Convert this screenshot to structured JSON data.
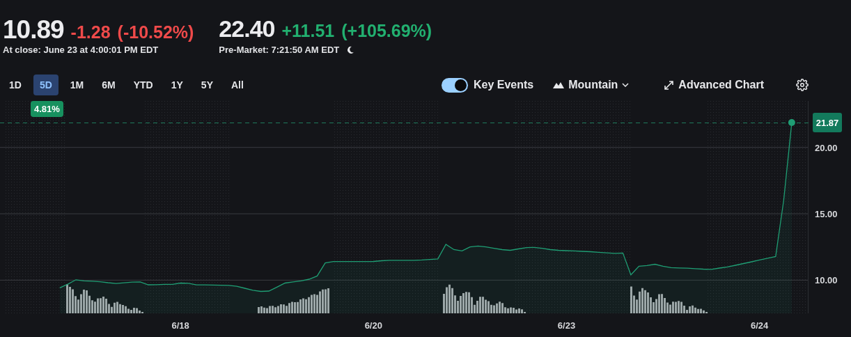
{
  "quote": {
    "close_price": "10.89",
    "close_change": "-1.28",
    "close_change_pct": "(-10.52%)",
    "close_time": "At close: June 23 at 4:00:01 PM EDT",
    "pre_price": "22.40",
    "pre_change": "+11.51",
    "pre_change_pct": "(+105.69%)",
    "pre_time": "Pre-Market: 7:21:50 AM EDT"
  },
  "ranges": [
    {
      "label": "1D",
      "selected": false
    },
    {
      "label": "5D",
      "selected": true
    },
    {
      "label": "1M",
      "selected": false
    },
    {
      "label": "6M",
      "selected": false
    },
    {
      "label": "YTD",
      "selected": false
    },
    {
      "label": "1Y",
      "selected": false
    },
    {
      "label": "5Y",
      "selected": false
    },
    {
      "label": "All",
      "selected": false
    }
  ],
  "range_change": "4.81%",
  "key_events": {
    "label": "Key Events",
    "on": true
  },
  "chart_type": "Mountain",
  "advanced_chart": "Advanced Chart",
  "chart": {
    "price_tag": "21.87",
    "chart_data": {
      "type": "area",
      "grid": true,
      "ylim": [
        7.5,
        23.5
      ],
      "yticks": [
        {
          "value": 10,
          "label": "10.00"
        },
        {
          "value": 15,
          "label": "15.00"
        },
        {
          "value": 20,
          "label": "20.00"
        }
      ],
      "categories": [
        null,
        null,
        null,
        null,
        null,
        null,
        null,
        null,
        null,
        null,
        null,
        null,
        null,
        null,
        null,
        "6/18",
        null,
        null,
        null,
        null,
        null,
        null,
        null,
        null,
        null,
        null,
        null,
        null,
        null,
        null,
        null,
        null,
        null,
        null,
        null,
        null,
        null,
        null,
        null,
        "6/20",
        null,
        null,
        null,
        null,
        null,
        null,
        null,
        null,
        null,
        null,
        null,
        null,
        null,
        null,
        null,
        null,
        null,
        null,
        null,
        null,
        null,
        null,
        null,
        "6/23",
        null,
        null,
        null,
        null,
        null,
        null,
        null,
        null,
        null,
        null,
        null,
        null,
        null,
        null,
        null,
        null,
        null,
        null,
        null,
        null,
        null,
        null,
        null,
        "6/24",
        null,
        null,
        null,
        null
      ],
      "series": [
        {
          "color": "#1f9e74",
          "values": [
            9.42,
            9.7,
            10.03,
            9.95,
            9.92,
            9.88,
            9.81,
            9.75,
            9.8,
            9.85,
            9.87,
            9.65,
            9.66,
            9.68,
            9.69,
            9.78,
            9.76,
            9.64,
            9.64,
            9.63,
            9.62,
            9.61,
            9.54,
            9.39,
            9.24,
            9.15,
            9.18,
            9.47,
            9.78,
            9.87,
            9.95,
            10.07,
            10.31,
            11.3,
            11.4,
            11.4,
            11.4,
            11.4,
            11.4,
            11.41,
            11.46,
            11.5,
            11.5,
            11.5,
            11.5,
            11.52,
            11.56,
            11.6,
            12.7,
            12.3,
            12.2,
            12.5,
            12.57,
            12.5,
            12.4,
            12.3,
            12.25,
            12.35,
            12.45,
            12.47,
            12.4,
            12.3,
            12.25,
            12.22,
            12.2,
            12.17,
            12.14,
            12.1,
            12.06,
            12.02,
            12.05,
            10.4,
            11.05,
            11.1,
            11.2,
            11.05,
            10.94,
            10.92,
            10.9,
            10.87,
            10.83,
            10.81,
            10.91,
            11.0,
            11.12,
            11.25,
            11.38,
            11.52,
            11.65,
            11.78,
            16.0,
            21.87
          ]
        }
      ]
    }
  }
}
